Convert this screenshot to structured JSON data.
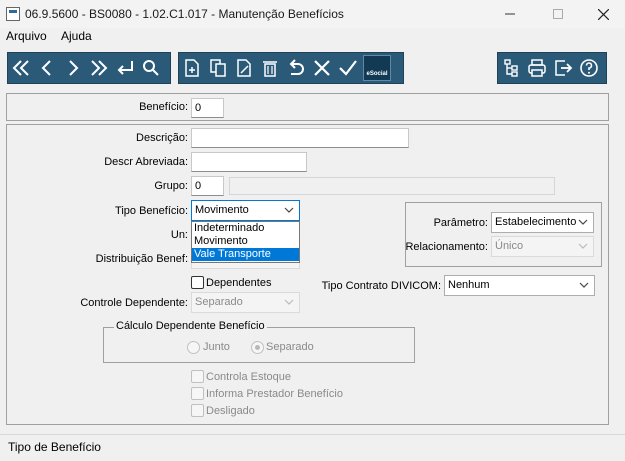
{
  "window": {
    "title": "06.9.5600 - BS0080 - 1.02.C1.017 - Manutenção Benefícios"
  },
  "menu": {
    "items": [
      "Arquivo",
      "Ajuda"
    ]
  },
  "toolbar": {
    "nav_icons": [
      "first-icon",
      "previous-icon",
      "next-icon",
      "last-icon",
      "goto-icon",
      "search-icon"
    ],
    "edit_icons": [
      "new-icon",
      "copy-icon",
      "edit-icon",
      "delete-icon",
      "undo-icon",
      "cancel-icon",
      "confirm-icon"
    ],
    "esocial_label": "eSocial",
    "right_icons": [
      "tree-icon",
      "print-icon",
      "exit-icon",
      "help-icon"
    ],
    "colors": {
      "background": "#2b5a78",
      "icon": "#ffffff"
    }
  },
  "form": {
    "beneficio": {
      "label": "Benefício:",
      "value": "0"
    },
    "descricao": {
      "label": "Descrição:",
      "value": ""
    },
    "descr_abreviada": {
      "label": "Descr Abreviada:",
      "value": ""
    },
    "grupo": {
      "label": "Grupo:",
      "value": "0",
      "description": ""
    },
    "tipo_beneficio": {
      "label": "Tipo Benefício:",
      "value": "Movimento",
      "options": [
        "Indeterminado",
        "Movimento",
        "Vale Transporte"
      ],
      "highlighted": "Vale Transporte"
    },
    "unidade": {
      "label": "Un:"
    },
    "distribuicao": {
      "label": "Distribuição Benef:"
    },
    "parametro": {
      "label": "Parâmetro:",
      "value": "Estabelecimento"
    },
    "relacionamento": {
      "label": "Relacionamento:",
      "value": "Único"
    },
    "dependentes": {
      "label": "Dependentes",
      "checked": false
    },
    "tipo_contrato": {
      "label": "Tipo Contrato DIVICOM:",
      "value": "Nenhum"
    },
    "controle_dependente": {
      "label": "Controle Dependente:",
      "value": "Separado"
    },
    "calculo": {
      "title": "Cálculo Dependente Benefício",
      "options": [
        "Junto",
        "Separado"
      ],
      "selected": "Separado"
    },
    "controla_estoque": {
      "label": "Controla Estoque",
      "checked": false
    },
    "informa_prestador": {
      "label": "Informa Prestador Benefício",
      "checked": false
    },
    "desligado": {
      "label": "Desligado",
      "checked": false
    }
  },
  "status": {
    "text": "Tipo de Benefício"
  }
}
